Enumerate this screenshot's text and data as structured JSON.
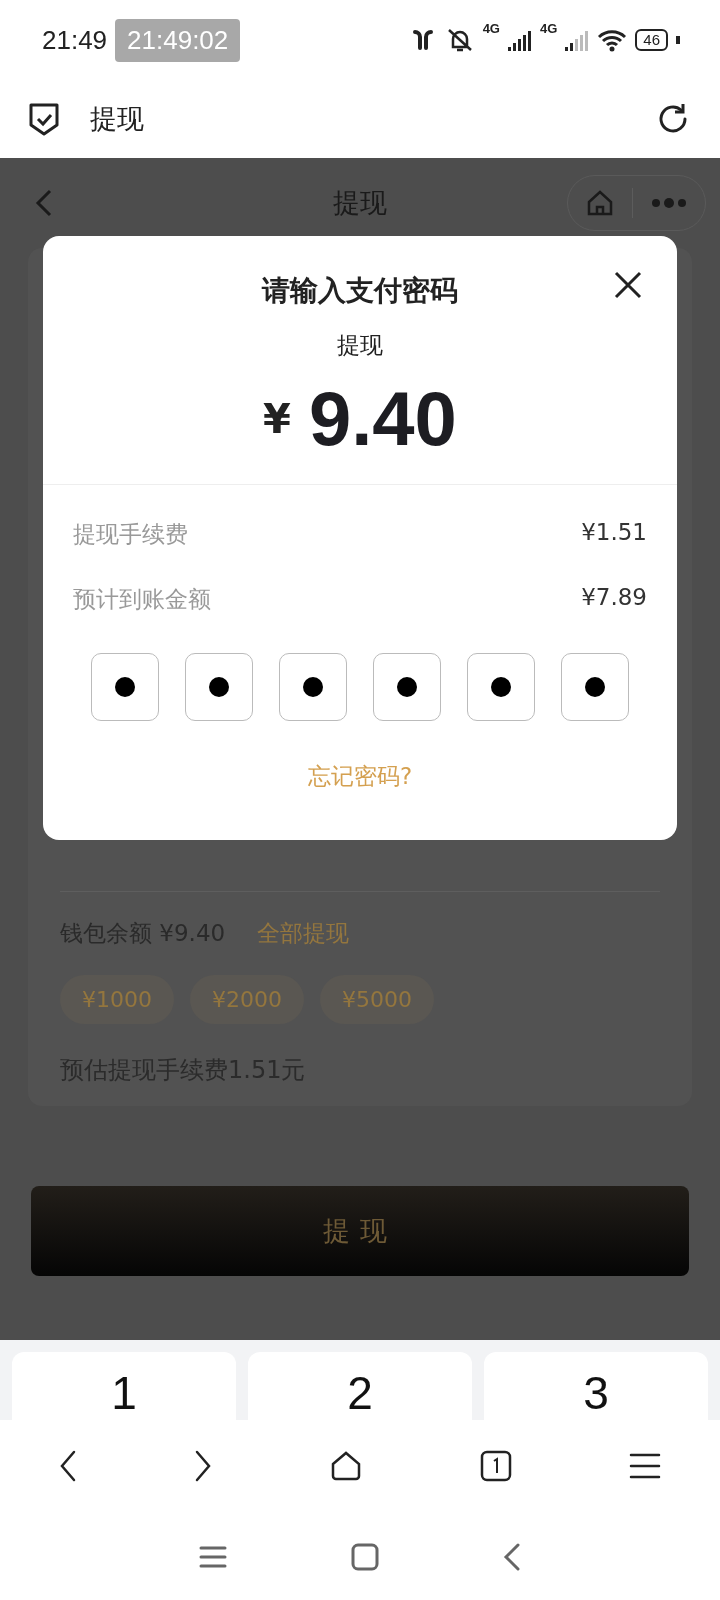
{
  "status_bar": {
    "time": "21:49",
    "recording_time": "21:49:02",
    "network_1": "4G",
    "network_2": "4G",
    "battery": "46"
  },
  "browser_header": {
    "title": "提现"
  },
  "page": {
    "title": "提现",
    "wallet_label": "钱包余额 ¥9.40",
    "withdraw_all": "全部提现",
    "quick_amounts": [
      "¥1000",
      "¥2000",
      "¥5000"
    ],
    "fee_note": "预估提现手续费1.51元",
    "submit": "提现"
  },
  "dialog": {
    "title": "请输入支付密码",
    "subtitle": "提现",
    "currency": "¥",
    "amount": "9.40",
    "rows": [
      {
        "label": "提现手续费",
        "value": "¥1.51"
      },
      {
        "label": "预计到账金额",
        "value": "¥7.89"
      }
    ],
    "pin": [
      {
        "filled": true
      },
      {
        "filled": true
      },
      {
        "filled": true
      },
      {
        "filled": true
      },
      {
        "filled": true
      },
      {
        "filled": true
      }
    ],
    "forgot": "忘记密码?"
  },
  "keypad": {
    "keys": [
      "1",
      "2",
      "3"
    ]
  }
}
